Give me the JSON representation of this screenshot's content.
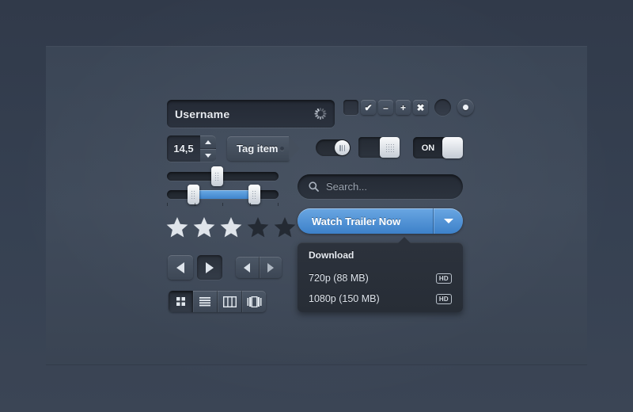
{
  "theme": {
    "background": "#333c4d",
    "panel": "#3e4959",
    "accent_blue": "#4a8bd0",
    "text_light": "#e9edf3",
    "text_muted": "#9aa3af"
  },
  "form": {
    "username_field": {
      "value": "Username",
      "spinner_icon": "loading-spinner-icon"
    },
    "checkboxes": [
      {
        "name": "checkbox-empty",
        "glyph": "",
        "state": "off"
      },
      {
        "name": "checkbox-checked",
        "glyph": "✔",
        "state": "on"
      },
      {
        "name": "checkbox-minus",
        "glyph": "–",
        "state": "on"
      },
      {
        "name": "checkbox-plus",
        "glyph": "+",
        "state": "on"
      },
      {
        "name": "checkbox-close",
        "glyph": "✖",
        "state": "on"
      }
    ],
    "radios": [
      {
        "name": "radio-unselected",
        "state": "off"
      },
      {
        "name": "radio-selected",
        "state": "on"
      }
    ],
    "stepper": {
      "value": "14,5",
      "up_icon": "chevron-up-icon",
      "down_icon": "chevron-down-icon"
    },
    "tag": {
      "label": "Tag item"
    },
    "toggles": [
      {
        "name": "toggle-pill",
        "label": "",
        "state": "on"
      },
      {
        "name": "toggle-square",
        "label": "",
        "state": "on"
      },
      {
        "name": "toggle-labeled",
        "label": "ON",
        "state": "on"
      }
    ]
  },
  "sliders": {
    "single": {
      "value_percent": 45
    },
    "range": {
      "start_percent": 23,
      "end_percent": 81
    }
  },
  "rating": {
    "value": 3,
    "max": 5
  },
  "media": {
    "prev_button": {
      "icon": "play-prev-icon",
      "state": "normal"
    },
    "play_button": {
      "icon": "play-icon",
      "state": "pressed"
    },
    "pair_prev": {
      "icon": "arrow-left-icon"
    },
    "pair_next": {
      "icon": "arrow-right-icon"
    }
  },
  "view_modes": [
    {
      "name": "view-grid",
      "icon": "grid-view-icon",
      "active": true
    },
    {
      "name": "view-list",
      "icon": "list-view-icon",
      "active": false
    },
    {
      "name": "view-columns",
      "icon": "column-view-icon",
      "active": false
    },
    {
      "name": "view-coverflow",
      "icon": "coverflow-view-icon",
      "active": false
    }
  ],
  "search": {
    "placeholder": "Search...",
    "icon": "search-icon"
  },
  "cta": {
    "label": "Watch Trailer Now",
    "dropdown_icon": "caret-down-icon"
  },
  "dropdown": {
    "title": "Download",
    "items": [
      {
        "label": "720p (88 MB)",
        "badge": "HD"
      },
      {
        "label": "1080p (150 MB)",
        "badge": "HD"
      }
    ]
  }
}
